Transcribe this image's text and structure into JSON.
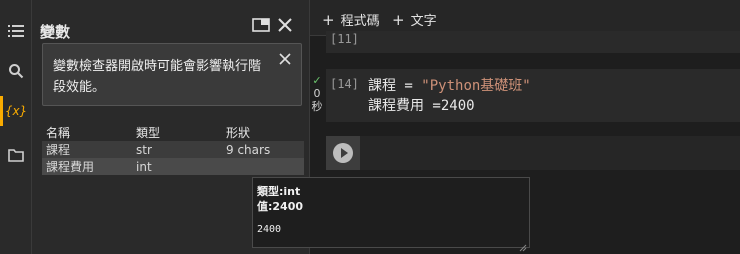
{
  "rail": {
    "icons": [
      "menu-icon",
      "search-icon",
      "variables-icon",
      "folder-icon"
    ],
    "variables_label": "{x}"
  },
  "panel": {
    "title": "變數",
    "notice": "變數檢查器開啟時可能會影響執行階段效能。",
    "columns": [
      "名稱",
      "類型",
      "形狀"
    ],
    "rows": [
      {
        "name": "課程",
        "type": "str",
        "shape": "9 chars"
      },
      {
        "name": "課程費用",
        "type": "int",
        "shape": ""
      }
    ]
  },
  "toolbar": {
    "add_code": "程式碼",
    "add_text": "文字"
  },
  "cells": {
    "prev_prompt": "[11]",
    "main_prompt": "[14]",
    "status_time": "0",
    "status_unit": "秒",
    "line1_prefix": "課程 = ",
    "line1_string": "\"Python基礎班\"",
    "line2": "課程費用 =2400"
  },
  "tooltip": {
    "type_line": "類型:int",
    "value_line": "值:2400",
    "repr_line": "2400"
  },
  "colors": {
    "accent": "#f9ab00",
    "success": "#6bc46d",
    "string": "#ce9178"
  }
}
